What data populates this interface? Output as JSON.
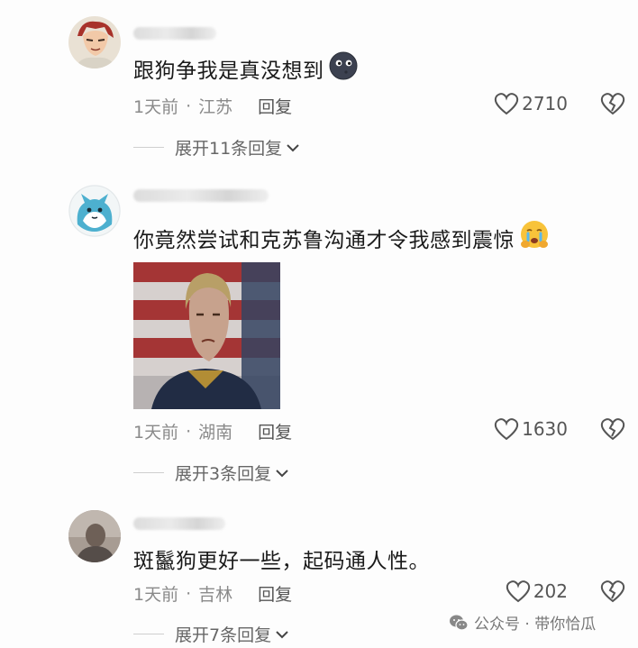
{
  "comments": [
    {
      "avatar_icon": "anime-character-avatar",
      "text": "跟狗争我是真没想到",
      "emoji_icon": "dark-moon-face-emoji",
      "time": "1天前",
      "separator": "·",
      "location": "江苏",
      "reply_label": "回复",
      "likes": "2710",
      "expand_label": "展开11条回复"
    },
    {
      "avatar_icon": "blue-cat-avatar",
      "text": "你竟然尝试和克苏鲁沟通才令我感到震惊",
      "emoji_icon": "crying-face-emoji",
      "image_icon": "man-in-front-of-flag-photo",
      "time": "1天前",
      "separator": "·",
      "location": "湖南",
      "reply_label": "回复",
      "likes": "1630",
      "expand_label": "展开3条回复"
    },
    {
      "avatar_icon": "person-photo-avatar",
      "text": "斑鬣狗更好一些，起码通人性。",
      "time": "1天前",
      "separator": "·",
      "location": "吉林",
      "reply_label": "回复",
      "likes": "202",
      "expand_label": "展开7条回复"
    }
  ],
  "watermark": {
    "icon": "wechat-icon",
    "text": "公众号 · 带你恰瓜"
  },
  "colors": {
    "text": "#1a1a1a",
    "meta": "#8a8a8a",
    "accent_dark": "#555555"
  }
}
